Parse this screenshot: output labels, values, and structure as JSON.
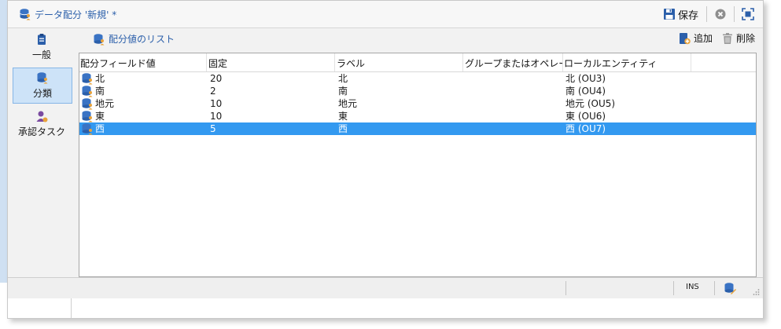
{
  "window": {
    "title": "データ配分 '新規' *",
    "save_label": "保存"
  },
  "sidebar": {
    "items": [
      {
        "label": "一般",
        "icon": "clipboard-icon",
        "active": false
      },
      {
        "label": "分類",
        "icon": "database-user-icon",
        "active": true
      },
      {
        "label": "承認タスク",
        "icon": "user-approval-icon",
        "active": false
      }
    ]
  },
  "panel": {
    "title": "配分値のリスト",
    "add_label": "追加",
    "delete_label": "削除"
  },
  "table": {
    "columns": [
      "配分フィールド値",
      "固定",
      "ラベル",
      "グループまたはオペレー…",
      "ローカルエンティティ"
    ],
    "rows": [
      {
        "value": "北",
        "fixed": "20",
        "label": "北",
        "group": "",
        "entity": "北 (OU3)",
        "selected": false
      },
      {
        "value": "南",
        "fixed": "2",
        "label": "南",
        "group": "",
        "entity": "南 (OU4)",
        "selected": false
      },
      {
        "value": "地元",
        "fixed": "10",
        "label": "地元",
        "group": "",
        "entity": "地元 (OU5)",
        "selected": false
      },
      {
        "value": "東",
        "fixed": "10",
        "label": "東",
        "group": "",
        "entity": "東 (OU6)",
        "selected": false
      },
      {
        "value": "西",
        "fixed": "5",
        "label": "西",
        "group": "",
        "entity": "西 (OU7)",
        "selected": true
      }
    ]
  },
  "statusbar": {
    "mode": "INS"
  },
  "colors": {
    "accent": "#2b5faa",
    "selection": "#3399f0",
    "active_nav": "#cde3f8"
  }
}
